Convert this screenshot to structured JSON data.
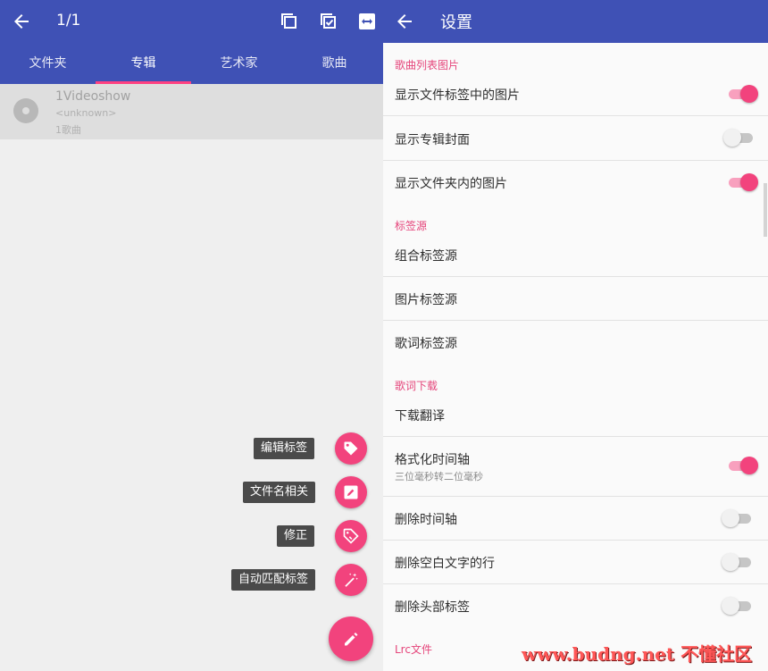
{
  "left": {
    "appbar": {
      "count": "1/1"
    },
    "tabs": [
      "文件夹",
      "专辑",
      "艺术家",
      "歌曲"
    ],
    "album": {
      "title": "1Videoshow",
      "artist": "<unknown>",
      "songs": "1歌曲"
    },
    "fab_menu": [
      "编辑标签",
      "文件名相关",
      "修正",
      "自动匹配标签"
    ]
  },
  "right": {
    "title": "设置",
    "sections": {
      "s1": "歌曲列表图片",
      "s2": "标签源",
      "s3": "歌词下载",
      "s4": "Lrc文件"
    },
    "items": {
      "show_tag_image": "显示文件标签中的图片",
      "show_album_cover": "显示专辑封面",
      "show_folder_image": "显示文件夹内的图片",
      "combined_tag_source": "组合标签源",
      "image_tag_source": "图片标签源",
      "lyrics_tag_source": "歌词标签源",
      "download_translation": "下载翻译",
      "format_timeline": "格式化时间轴",
      "format_timeline_sub": "三位毫秒转二位毫秒",
      "delete_timeline": "删除时间轴",
      "delete_blank_lines": "删除空白文字的行",
      "delete_header_tags": "删除头部标签"
    },
    "toggles": {
      "show_tag_image": true,
      "show_album_cover": false,
      "show_folder_image": true,
      "format_timeline": true,
      "delete_timeline": false,
      "delete_blank_lines": false,
      "delete_header_tags": false
    }
  },
  "watermark": "www.budng.net 不懂社区",
  "colors": {
    "primary": "#3f51b5",
    "accent": "#f2437d",
    "section": "#e5457b"
  }
}
